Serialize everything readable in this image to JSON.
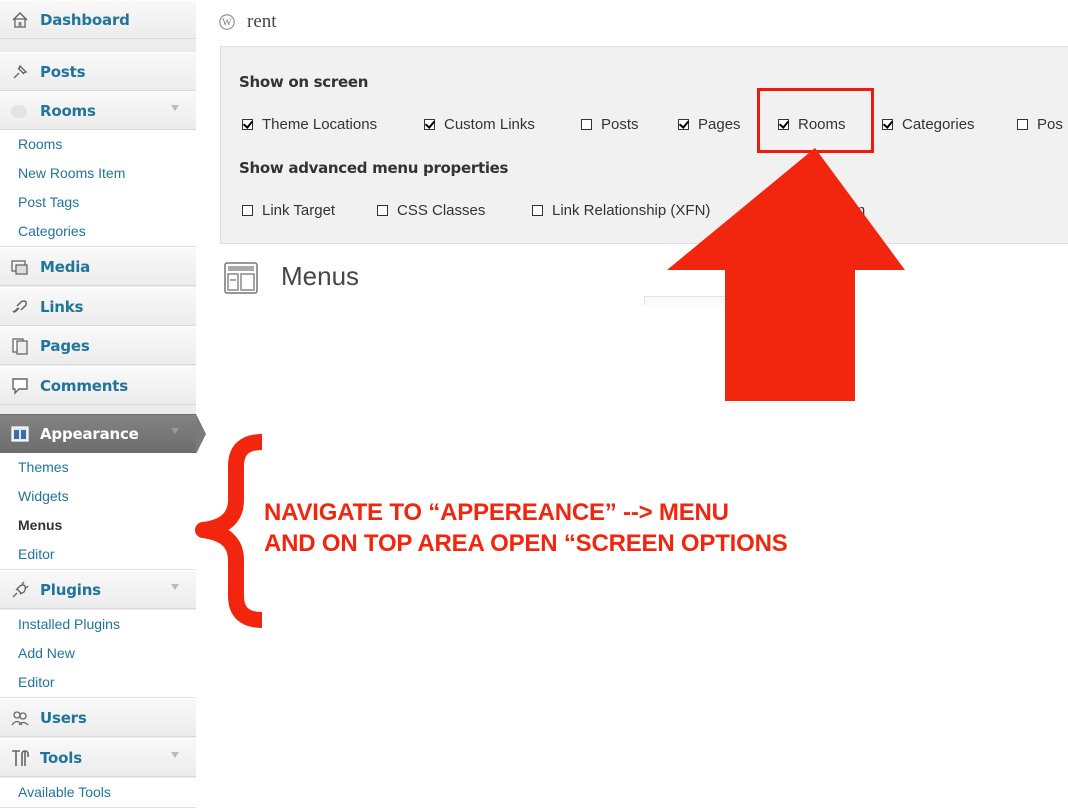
{
  "sidebar": {
    "dashboard": "Dashboard",
    "posts": "Posts",
    "rooms": "Rooms",
    "rooms_sub": [
      "Rooms",
      "New Rooms Item",
      "Post Tags",
      "Categories"
    ],
    "media": "Media",
    "links": "Links",
    "pages": "Pages",
    "comments": "Comments",
    "appearance": "Appearance",
    "appearance_sub": [
      "Themes",
      "Widgets",
      "Menus",
      "Editor"
    ],
    "plugins": "Plugins",
    "plugins_sub": [
      "Installed Plugins",
      "Add New",
      "Editor"
    ],
    "users": "Users",
    "tools": "Tools",
    "tools_sub": [
      "Available Tools"
    ]
  },
  "header": {
    "site_name": "rent"
  },
  "screen_options": {
    "show_on_screen": "Show on screen",
    "boxes": [
      {
        "label": "Theme Locations",
        "checked": true
      },
      {
        "label": "Custom Links",
        "checked": true
      },
      {
        "label": "Posts",
        "checked": false
      },
      {
        "label": "Pages",
        "checked": true
      },
      {
        "label": "Rooms",
        "checked": true
      },
      {
        "label": "Categories",
        "checked": true
      },
      {
        "label": "Pos",
        "checked": false
      }
    ],
    "advanced_heading": "Show advanced menu properties",
    "advanced": [
      {
        "label": "Link Target",
        "checked": false
      },
      {
        "label": "CSS Classes",
        "checked": false
      },
      {
        "label": "Link Relationship (XFN)",
        "checked": false
      },
      {
        "label": "tion",
        "checked": false
      }
    ]
  },
  "page": {
    "title": "Menus"
  },
  "annotation": {
    "line1": "NAVIGATE TO “APPEREANCE” --> MENU",
    "line2": "AND ON TOP AREA OPEN “SCREEN OPTIONS",
    "color": "#f2260f"
  }
}
